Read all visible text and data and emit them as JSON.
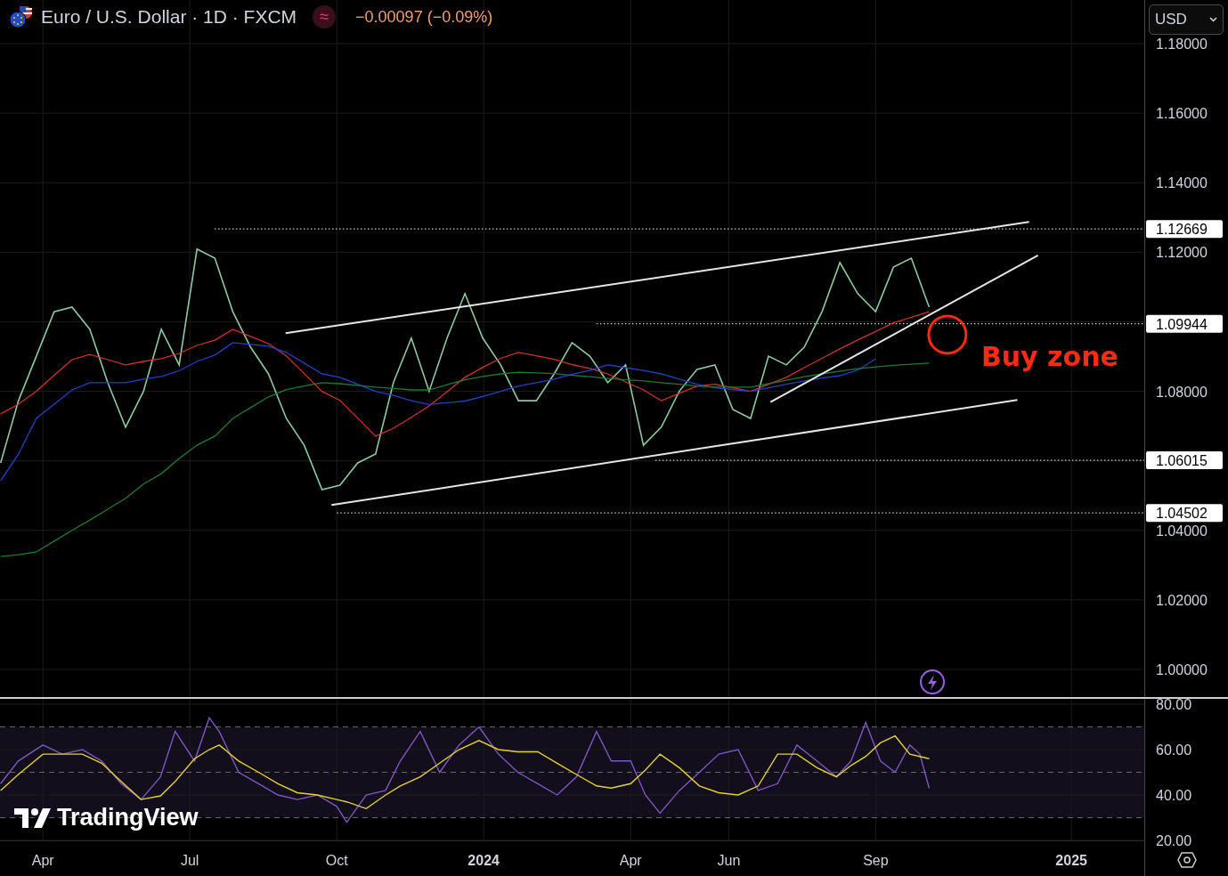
{
  "header": {
    "title": "Euro / U.S. Dollar · 1D · FXCM",
    "status_symbol": "≈",
    "change": "−0.00097 (−0.09%)"
  },
  "currency_button": {
    "label": "USD"
  },
  "price_chart": {
    "chart_data": {
      "type": "line",
      "ylim": [
        1.0,
        1.18
      ],
      "yticks": [
        {
          "value": 1.18,
          "label": "1.18000"
        },
        {
          "value": 1.16,
          "label": "1.16000"
        },
        {
          "value": 1.14,
          "label": "1.14000"
        },
        {
          "value": 1.12,
          "label": "1.12000"
        },
        {
          "value": 1.08,
          "label": "1.08000"
        },
        {
          "value": 1.04,
          "label": "1.04000"
        },
        {
          "value": 1.02,
          "label": "1.02000"
        },
        {
          "value": 1.0,
          "label": "1.00000"
        }
      ],
      "series": [
        {
          "color": "#8fc9a0",
          "values": [
            1.0594,
            1.0773,
            1.0901,
            1.1029,
            1.1042,
            1.0978,
            1.0825,
            1.0697,
            1.08,
            1.0978,
            1.0876,
            1.1209,
            1.1183,
            1.1029,
            1.0927,
            1.085,
            1.0722,
            1.0645,
            1.0517,
            1.053,
            1.0594,
            1.062,
            1.0825,
            1.0953,
            1.08,
            1.0953,
            1.1081,
            1.0953,
            1.0876,
            1.0773,
            1.0773,
            1.085,
            1.094,
            1.0901,
            1.0825,
            1.0876,
            1.0645,
            1.0697,
            1.08,
            1.0863,
            1.0876,
            1.0748,
            1.0722,
            1.0901,
            1.0876,
            1.0927,
            1.1029,
            1.117,
            1.1081,
            1.1029,
            1.1157,
            1.1183,
            1.1042
          ]
        },
        {
          "color": "#d32f2f",
          "values": [
            1.0735,
            1.0763,
            1.08,
            1.0846,
            1.0891,
            1.0906,
            1.0891,
            1.0876,
            1.0886,
            1.0894,
            1.0909,
            1.0932,
            1.0947,
            1.0978,
            1.0958,
            1.0937,
            1.0902,
            1.0851,
            1.08,
            1.0774,
            1.0723,
            1.0671,
            1.0694,
            1.0725,
            1.0758,
            1.0799,
            1.084,
            1.0869,
            1.0895,
            1.0912,
            1.0902,
            1.0892,
            1.0877,
            1.0866,
            1.085,
            1.0827,
            1.0804,
            1.0773,
            1.0794,
            1.0815,
            1.082,
            1.081,
            1.08,
            1.082,
            1.084,
            1.0868,
            1.0895,
            1.0922,
            1.0948,
            1.0972,
            1.0997,
            1.1013,
            1.1029
          ]
        },
        {
          "color": "#2440c8",
          "values": [
            1.0543,
            1.0619,
            1.0722,
            1.0763,
            1.0804,
            1.0825,
            1.0825,
            1.0825,
            1.0835,
            1.0843,
            1.0859,
            1.0886,
            1.0904,
            1.094,
            1.0935,
            1.093,
            1.0912,
            1.0881,
            1.085,
            1.084,
            1.082,
            1.08,
            1.0788,
            1.0773,
            1.0762,
            1.0767,
            1.0772,
            1.0785,
            1.08,
            1.0815,
            1.0825,
            1.0835,
            1.0849,
            1.086,
            1.0876,
            1.0868,
            1.086,
            1.085,
            1.0835,
            1.082,
            1.081,
            1.0805,
            1.08,
            1.081,
            1.082,
            1.083,
            1.0838,
            1.0845,
            1.0861,
            1.0893,
            null,
            null,
            null
          ]
        },
        {
          "color": "#1f7a30",
          "values": [
            1.0325,
            1.033,
            1.0338,
            1.0369,
            1.04,
            1.043,
            1.0461,
            1.0492,
            1.0533,
            1.0563,
            1.0607,
            1.0645,
            1.0671,
            1.0722,
            1.0753,
            1.0784,
            1.0805,
            1.0815,
            1.0825,
            1.0822,
            1.0817,
            1.0812,
            1.0808,
            1.0804,
            1.0804,
            1.0819,
            1.0833,
            1.0843,
            1.085,
            1.0855,
            1.0853,
            1.0851,
            1.0846,
            1.0842,
            1.0837,
            1.0833,
            1.083,
            1.0825,
            1.082,
            1.0815,
            1.0812,
            1.0812,
            1.0812,
            1.0822,
            1.0832,
            1.0842,
            1.085,
            1.0858,
            1.0865,
            1.087,
            1.0875,
            1.0878,
            1.0881
          ]
        }
      ],
      "grid": true,
      "ref_lines": [
        {
          "axis": "y",
          "value": 1.12669,
          "label": "1.12669"
        },
        {
          "axis": "y",
          "value": 1.09944,
          "label": "1.09944"
        },
        {
          "axis": "y",
          "value": 1.06015,
          "label": "1.06015"
        },
        {
          "axis": "y",
          "value": 1.04502,
          "label": "1.04502"
        }
      ],
      "annotations": [
        {
          "text": "Buy zone"
        }
      ]
    }
  },
  "rsi_chart": {
    "chart_data": {
      "type": "line",
      "ylim": [
        20,
        80
      ],
      "grid": true,
      "xlim": [
        2023.177,
        2025.124
      ],
      "x": [
        2023.178,
        2023.208,
        2023.25,
        2023.283,
        2023.317,
        2023.35,
        2023.383,
        2023.417,
        2023.45,
        2023.475,
        2023.508,
        2023.533,
        2023.55,
        2023.583,
        2023.617,
        2023.65,
        2023.683,
        2023.717,
        2023.75,
        2023.767,
        2023.8,
        2023.833,
        2023.858,
        2023.892,
        2023.925,
        2023.958,
        2023.992,
        2024.025,
        2024.058,
        2024.092,
        2024.125,
        2024.158,
        2024.192,
        2024.217,
        2024.25,
        2024.275,
        2024.3,
        2024.333,
        2024.367,
        2024.4,
        2024.433,
        2024.467,
        2024.5,
        2024.533,
        2024.567,
        2024.6,
        2024.625,
        2024.65,
        2024.675,
        2024.7,
        2024.725,
        2024.742,
        2024.758
      ],
      "xticks": [
        {
          "value": 2023.25,
          "label": "Apr"
        },
        {
          "value": 2023.5,
          "label": "Jul"
        },
        {
          "value": 2023.75,
          "label": "Oct"
        },
        {
          "value": 2024,
          "label": "2024"
        },
        {
          "value": 2024.25,
          "label": "Apr"
        },
        {
          "value": 2024.417,
          "label": "Jun"
        },
        {
          "value": 2024.667,
          "label": "Sep"
        },
        {
          "value": 2025,
          "label": "2025"
        }
      ],
      "bands": [
        {
          "axis": "y",
          "from": 30,
          "to": 70,
          "color": "#120e1c"
        }
      ],
      "ref_lines": [
        {
          "axis": "y",
          "value": 70
        },
        {
          "axis": "y",
          "value": 50
        },
        {
          "axis": "y",
          "value": 30
        }
      ],
      "yticks": [
        {
          "value": 80,
          "label": "80.00"
        },
        {
          "value": 60,
          "label": "60.00"
        },
        {
          "value": 40,
          "label": "40.00"
        },
        {
          "value": 20,
          "label": "20.00"
        }
      ],
      "series": [
        {
          "color": "#7e57c2",
          "values": [
            45,
            55,
            62,
            58,
            60,
            55,
            45,
            38,
            48,
            68,
            55,
            74,
            68,
            50,
            45,
            40,
            38,
            40,
            35,
            28,
            40,
            42,
            55,
            68,
            50,
            62,
            70,
            58,
            50,
            45,
            40,
            48,
            68,
            55,
            55,
            40,
            32,
            42,
            50,
            58,
            60,
            42,
            45,
            62,
            55,
            48,
            55,
            72,
            55,
            50,
            62,
            58,
            43
          ]
        },
        {
          "color": "#e6d22a",
          "values": [
            42,
            49,
            58,
            58,
            58,
            54,
            46,
            38,
            39.6,
            46,
            56,
            60,
            62,
            55,
            50,
            45,
            41,
            40,
            38,
            37,
            34,
            40,
            44,
            48,
            54,
            60,
            64,
            60,
            59,
            59,
            54,
            49,
            44,
            43,
            45,
            51,
            58,
            52,
            44,
            41,
            40,
            44,
            58,
            58,
            52,
            48,
            53,
            57,
            63,
            66,
            58,
            57,
            56
          ]
        }
      ]
    }
  },
  "logo": {
    "text": "TradingView"
  }
}
